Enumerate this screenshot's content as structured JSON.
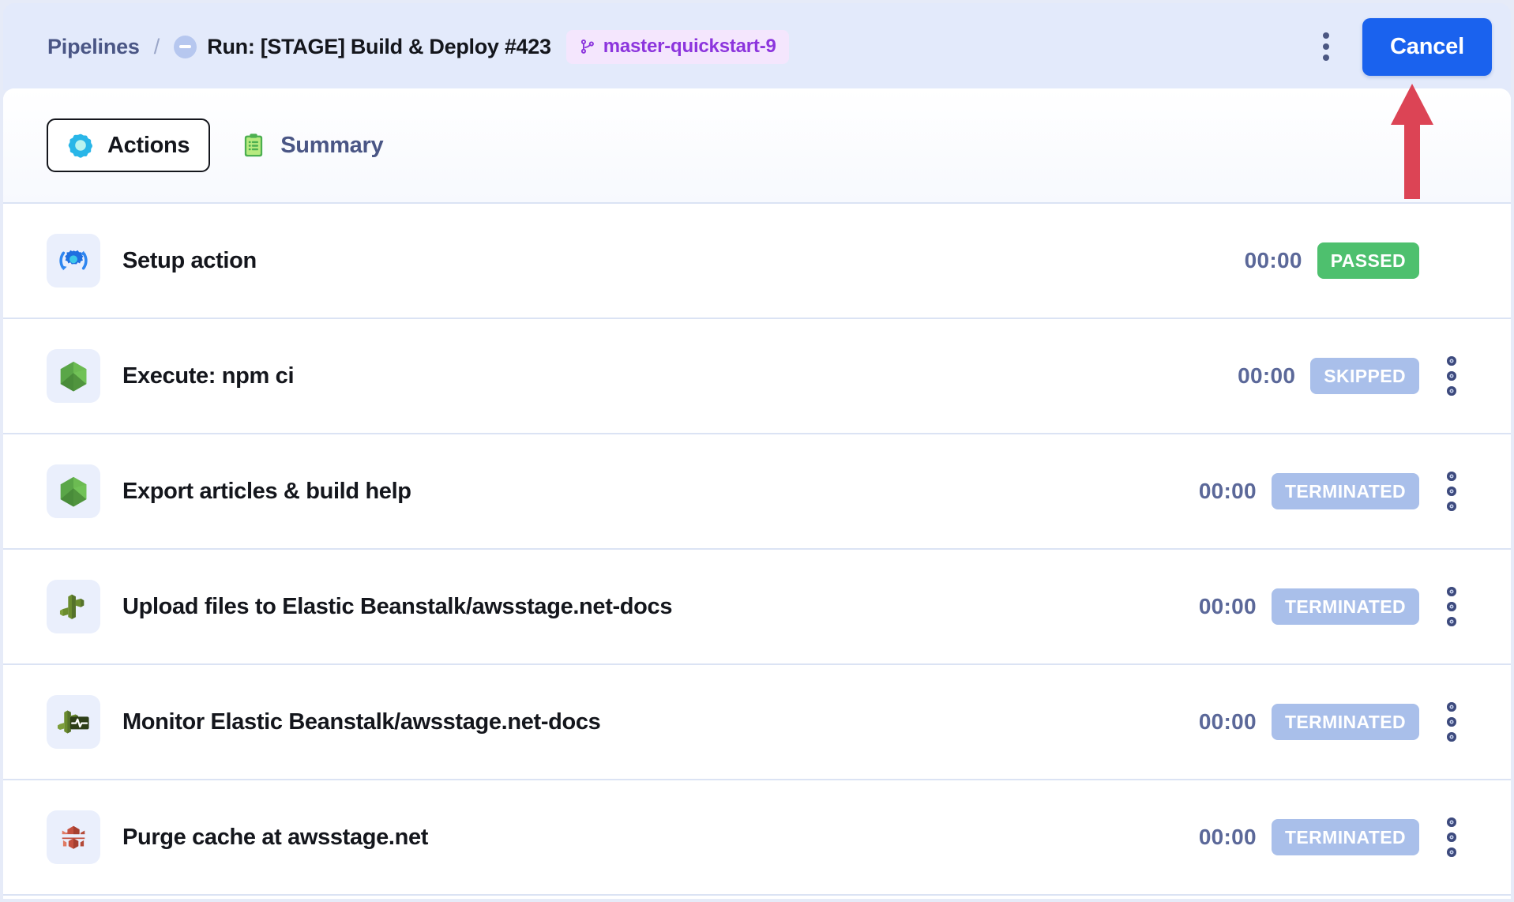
{
  "header": {
    "breadcrumb_root": "Pipelines",
    "breadcrumb_separator": "/",
    "run_title": "Run: [STAGE] Build & Deploy #423",
    "branch": "master-quickstart-9",
    "cancel_label": "Cancel",
    "menu_icon": "kebab-menu-icon",
    "run_status_icon": "minus-circle-icon",
    "branch_icon": "branch-icon"
  },
  "tabs": [
    {
      "label": "Actions",
      "icon": "gear-flower-icon",
      "active": true
    },
    {
      "label": "Summary",
      "icon": "clipboard-icon",
      "active": false
    }
  ],
  "actions": [
    {
      "label": "Setup action",
      "icon": "setup-gear-refresh-icon",
      "duration": "00:00",
      "status": "PASSED",
      "status_key": "passed",
      "has_menu": false
    },
    {
      "label": "Execute: npm ci",
      "icon": "nodejs-icon",
      "duration": "00:00",
      "status": "SKIPPED",
      "status_key": "skipped",
      "has_menu": true
    },
    {
      "label": "Export articles & build help",
      "icon": "nodejs-icon",
      "duration": "00:00",
      "status": "TERMINATED",
      "status_key": "terminated",
      "has_menu": true
    },
    {
      "label": "Upload files to Elastic Beanstalk/awsstage.net-docs",
      "icon": "elastic-beanstalk-icon",
      "duration": "00:00",
      "status": "TERMINATED",
      "status_key": "terminated",
      "has_menu": true
    },
    {
      "label": "Monitor Elastic Beanstalk/awsstage.net-docs",
      "icon": "elastic-beanstalk-monitor-icon",
      "duration": "00:00",
      "status": "TERMINATED",
      "status_key": "terminated",
      "has_menu": true
    },
    {
      "label": "Purge cache at awsstage.net",
      "icon": "cloudfront-icon",
      "duration": "00:00",
      "status": "TERMINATED",
      "status_key": "terminated",
      "has_menu": true
    }
  ],
  "annotation": {
    "arrow_icon": "up-arrow-annotation",
    "arrow_color": "#dc4455",
    "points_at": "cancel-button"
  },
  "colors": {
    "accent_blue": "#1a62ee",
    "passed_green": "#4ec06e",
    "muted_blue": "#a9bfea",
    "branch_purple": "#8c35dd",
    "page_bg": "#e6ebf8"
  }
}
